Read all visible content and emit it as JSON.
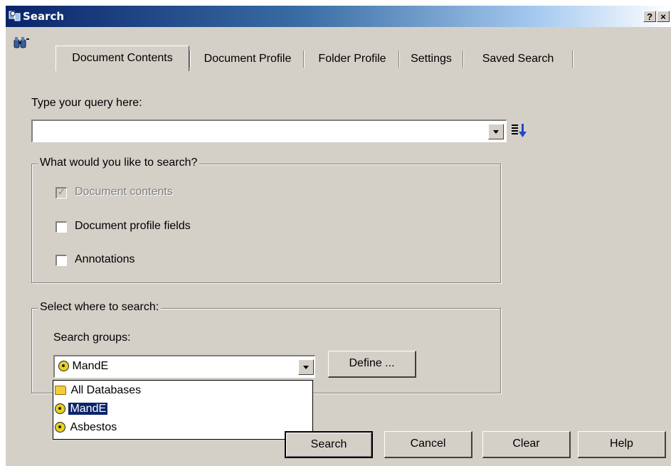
{
  "window": {
    "title": "Search",
    "help_glyph": "?",
    "close_glyph": "×"
  },
  "tabs": [
    {
      "label": "Document Contents",
      "active": true
    },
    {
      "label": "Document Profile",
      "active": false
    },
    {
      "label": "Folder Profile",
      "active": false
    },
    {
      "label": "Settings",
      "active": false
    },
    {
      "label": "Saved Search",
      "active": false
    }
  ],
  "query": {
    "label": "Type your query here:",
    "value": ""
  },
  "search_options": {
    "title": "What would you like to search?",
    "items": [
      {
        "label": "Document contents",
        "checked": true,
        "enabled": false
      },
      {
        "label": "Document profile fields",
        "checked": false,
        "enabled": true
      },
      {
        "label": "Annotations",
        "checked": false,
        "enabled": true
      }
    ]
  },
  "where": {
    "title": "Select where to search:",
    "groups_label": "Search groups:",
    "selected": "MandE",
    "define_label": "Define ...",
    "dropdown": [
      {
        "label": "All Databases",
        "icon": "folder-icon",
        "selected": false
      },
      {
        "label": "MandE",
        "icon": "hazard-icon",
        "selected": true
      },
      {
        "label": "Asbestos",
        "icon": "hazard-icon",
        "selected": false
      }
    ]
  },
  "buttons": {
    "search": "Search",
    "cancel": "Cancel",
    "clear": "Clear",
    "help": "Help"
  }
}
